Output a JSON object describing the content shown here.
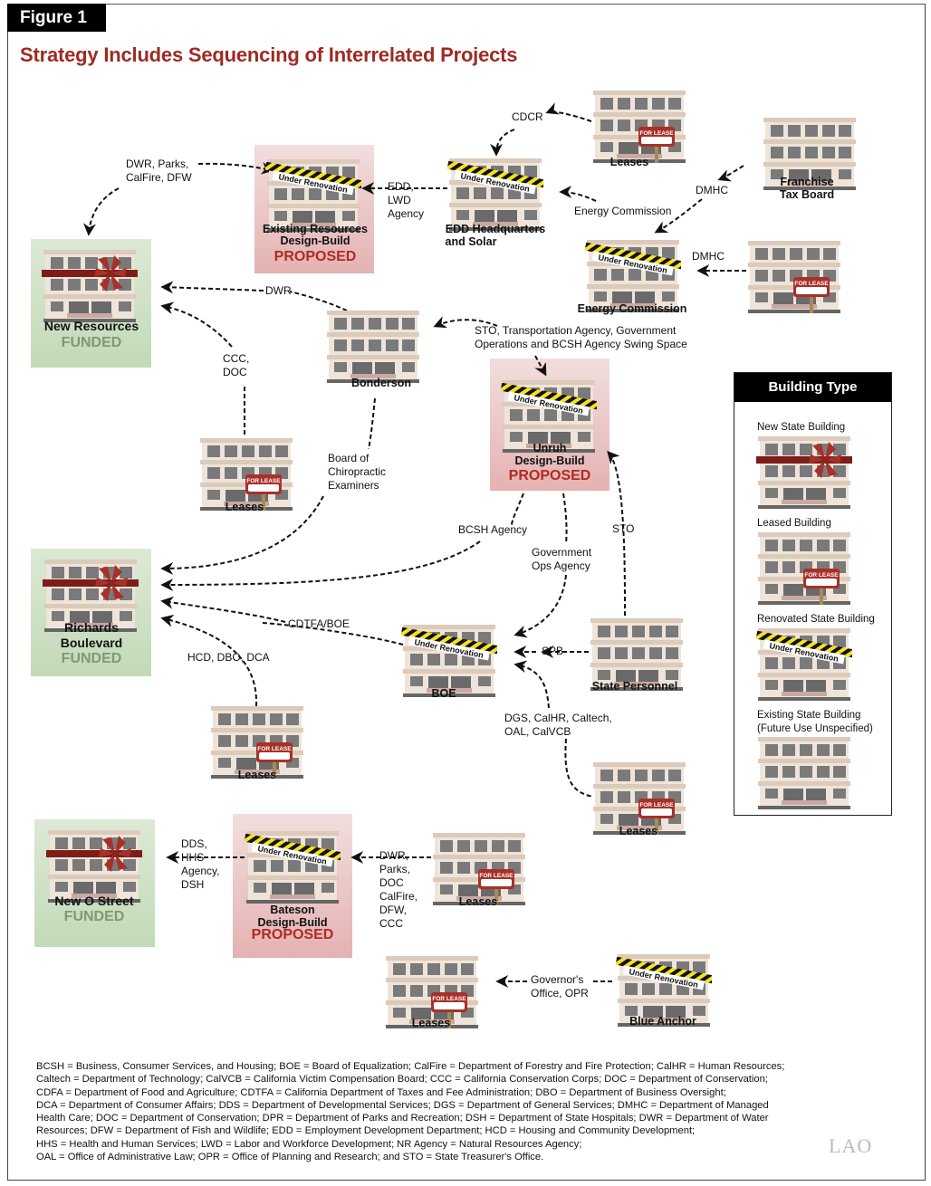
{
  "figure_label": "Figure 1",
  "title": "Strategy Includes Sequencing of Interrelated Projects",
  "status_labels": {
    "funded": "FUNDED",
    "proposed": "PROPOSED"
  },
  "building_text": {
    "under_renovation": "Under Renovation",
    "for_lease": "FOR LEASE"
  },
  "nodes": {
    "new_resources": {
      "name": "New Resources",
      "type": "new",
      "status": "FUNDED"
    },
    "existing_resources": {
      "name_line1": "Existing Resources",
      "name_line2": "Design-Build",
      "type": "renovated",
      "status": "PROPOSED"
    },
    "edd_hq": {
      "name_line1": "EDD Headquarters",
      "name_line2": "and Solar",
      "type": "renovated"
    },
    "leases_top": {
      "name": "Leases",
      "type": "leased"
    },
    "franchise_tax_board": {
      "name_line1": "Franchise",
      "name_line2": "Tax Board",
      "type": "existing"
    },
    "energy_commission": {
      "name": "Energy Commission",
      "type": "renovated"
    },
    "leases_dmhc": {
      "name": "",
      "type": "leased"
    },
    "bonderson": {
      "name": "Bonderson",
      "type": "existing"
    },
    "leases_ccc": {
      "name": "Leases",
      "type": "leased"
    },
    "unruh": {
      "name_line1": "Unruh",
      "name_line2": "Design-Build",
      "type": "renovated",
      "status": "PROPOSED"
    },
    "richards_boulevard": {
      "name_line1": "Richards",
      "name_line2": "Boulevard",
      "type": "new",
      "status": "FUNDED"
    },
    "boe": {
      "name": "BOE",
      "type": "renovated"
    },
    "state_personnel": {
      "name": "State Personnel",
      "type": "existing"
    },
    "leases_hcd": {
      "name": "Leases",
      "type": "leased"
    },
    "leases_dgs": {
      "name": "Leases",
      "type": "leased"
    },
    "new_o_street": {
      "name": "New O Street",
      "type": "new",
      "status": "FUNDED"
    },
    "bateson": {
      "name_line1": "Bateson",
      "name_line2": "Design-Build",
      "type": "renovated",
      "status": "PROPOSED"
    },
    "leases_dwr": {
      "name": "Leases",
      "type": "leased"
    },
    "leases_gov": {
      "name": "Leases",
      "type": "leased"
    },
    "blue_anchor": {
      "name": "Blue Anchor",
      "type": "renovated"
    }
  },
  "edges": [
    {
      "from": "existing_resources",
      "to": "new_resources",
      "label": [
        "DWR, Parks,",
        "CalFire, DFW"
      ]
    },
    {
      "from": "edd_hq",
      "to": "existing_resources",
      "label": [
        "EDD,",
        "LWD",
        "Agency"
      ]
    },
    {
      "from": "leases_top",
      "to": "edd_hq",
      "label": [
        "CDCR"
      ]
    },
    {
      "from": "energy_commission",
      "to": "edd_hq",
      "label": [
        "Energy Commission"
      ]
    },
    {
      "from": "franchise_tax_board",
      "to": "energy_commission",
      "label": [
        "DMHC"
      ]
    },
    {
      "from": "leases_dmhc",
      "to": "energy_commission",
      "label": [
        "DMHC"
      ]
    },
    {
      "from": "bonderson",
      "to": "new_resources",
      "label": [
        "DWR"
      ]
    },
    {
      "from": "leases_ccc",
      "to": "new_resources",
      "label": [
        "CCC,",
        "DOC"
      ]
    },
    {
      "from": "unruh",
      "to": "bonderson",
      "label": [
        "STO, Transportation Agency, Government",
        "Operations and BCSH Agency Swing Space"
      ]
    },
    {
      "from": "bonderson",
      "to": "richards_boulevard",
      "label": [
        "Board of",
        "Chiropractic",
        "Examiners"
      ]
    },
    {
      "from": "unruh",
      "to": "richards_boulevard",
      "label": [
        "BCSH Agency"
      ]
    },
    {
      "from": "unruh",
      "to": "boe",
      "label": [
        "Government",
        "Ops Agency"
      ]
    },
    {
      "from": "state_personnel",
      "to": "unruh",
      "label": [
        "STO"
      ]
    },
    {
      "from": "boe",
      "to": "richards_boulevard",
      "label": [
        "CDTFA/BOE"
      ]
    },
    {
      "from": "leases_hcd",
      "to": "richards_boulevard",
      "label": [
        "HCD, DBO, DCA"
      ]
    },
    {
      "from": "state_personnel",
      "to": "boe",
      "label": [
        "SPB"
      ]
    },
    {
      "from": "leases_dgs",
      "to": "boe",
      "label": [
        "DGS, CalHR, Caltech,",
        "OAL, CalVCB"
      ]
    },
    {
      "from": "bateson",
      "to": "new_o_street",
      "label": [
        "DDS,",
        "HHS",
        "Agency,",
        "DSH"
      ]
    },
    {
      "from": "leases_dwr",
      "to": "bateson",
      "label": [
        "DWR,",
        "Parks,",
        "DOC",
        "CalFire,",
        "DFW,",
        "CCC"
      ]
    },
    {
      "from": "blue_anchor",
      "to": "leases_gov",
      "label": [
        "Governor's",
        "Office, OPR"
      ]
    }
  ],
  "legend": {
    "title": "Building Type",
    "items": [
      {
        "label": "New State Building",
        "type": "new"
      },
      {
        "label": "Leased Building",
        "type": "leased"
      },
      {
        "label": "Renovated State Building",
        "type": "renovated"
      },
      {
        "label_line1": "Existing State Building",
        "label_line2": "(Future Use Unspecified)",
        "type": "existing"
      }
    ]
  },
  "footnote": [
    "BCSH = Business, Consumer Services, and Housing; BOE = Board of Equalization; CalFire = Department of Forestry and Fire Protection; CalHR = Human Resources;",
    "Caltech = Department of Technology; CalVCB = California Victim Compensation Board; CCC = California Conservation Corps; DOC = Department of Conservation;",
    "CDFA = Department of Food and Agriculture; CDTFA = California Department of Taxes and Fee Administration; DBO = Department of Business Oversight;",
    "DCA = Department of Consumer Affairs; DDS = Department of Developmental Services; DGS = Department of General Services; DMHC = Department of Managed",
    "Health Care; DOC = Department of Conservation; DPR = Department of Parks and Recreation; DSH = Department of State Hospitals; DWR = Department of Water",
    "Resources;  DFW = Department of Fish and Wildlife; EDD = Employment Development Department; HCD = Housing and Community Development;",
    "HHS = Health and Human Services; LWD = Labor and Workforce Development; NR Agency = Natural Resources Agency;",
    "OAL = Office of Administrative Law; OPR = Office of Planning and Research; and STO = State Treasurer's Office."
  ],
  "logo": "LAO",
  "colors": {
    "title": "#9e2a22",
    "funded_text": "#7e9a72",
    "proposed_text": "#b02a25",
    "funded_bg": "#cfe1c6",
    "proposed_bg": "#ebc4c4"
  }
}
